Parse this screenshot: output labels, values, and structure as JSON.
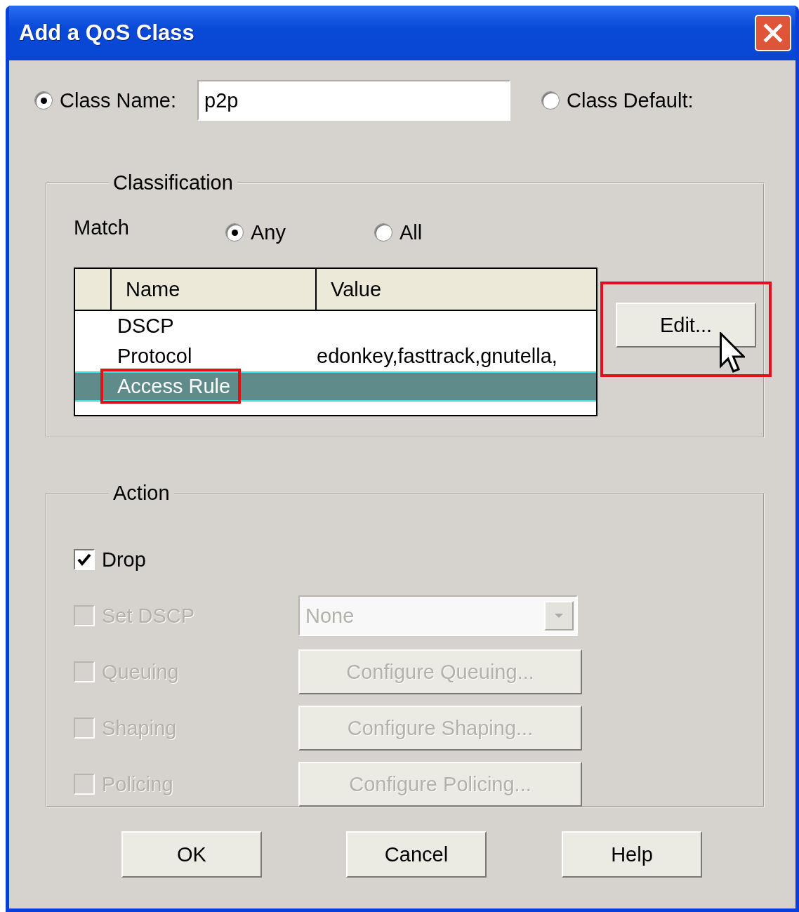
{
  "window": {
    "title": "Add a QoS Class"
  },
  "class_choice": [
    {
      "label": "Class Name:",
      "selected": true
    },
    {
      "label": "Class Default:",
      "selected": false
    }
  ],
  "class_name": {
    "value": "p2p"
  },
  "classification": {
    "title": "Classification",
    "match_label": "Match",
    "match_options": [
      {
        "label": "Any",
        "selected": true
      },
      {
        "label": "All",
        "selected": false
      }
    ],
    "table": {
      "columns": [
        "Name",
        "Value"
      ],
      "rows": [
        {
          "name": "DSCP",
          "selected": false,
          "highlighted": false
        },
        {
          "name": "Protocol",
          "value": "edonkey,fasttrack,gnutella,",
          "selected": false,
          "highlighted": false
        },
        {
          "name": "Access Rule",
          "selected": true,
          "highlighted": true
        }
      ]
    },
    "edit_button": {
      "label": "Edit...",
      "highlighted": true
    }
  },
  "action": {
    "title": "Action",
    "items": [
      {
        "kind": "plain",
        "label": "Drop",
        "checked": true,
        "disabled": false
      },
      {
        "kind": "dropdown",
        "label": "Set DSCP",
        "checked": false,
        "disabled": true,
        "value": "None"
      },
      {
        "kind": "button",
        "label": "Queuing",
        "checked": false,
        "disabled": true,
        "button": "Configure Queuing..."
      },
      {
        "kind": "button",
        "label": "Shaping",
        "checked": false,
        "disabled": true,
        "button": "Configure Shaping..."
      },
      {
        "kind": "button",
        "label": "Policing",
        "checked": false,
        "disabled": true,
        "button": "Configure Policing..."
      }
    ]
  },
  "buttons": [
    "OK",
    "Cancel",
    "Help"
  ]
}
